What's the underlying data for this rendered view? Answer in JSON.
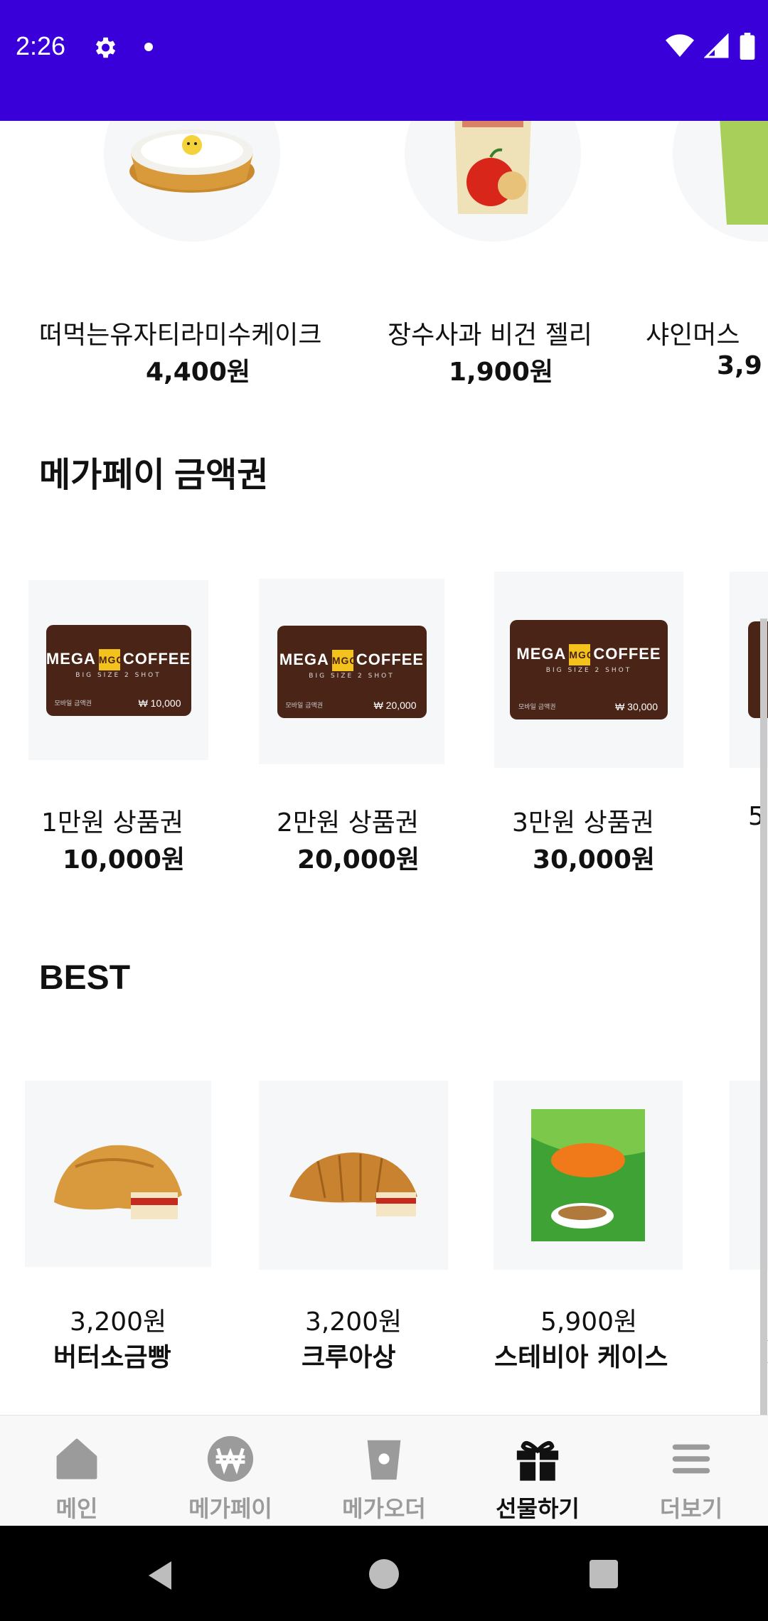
{
  "status_bar": {
    "time": "2:26",
    "background": "#3a00d9"
  },
  "top_products": [
    {
      "name": "떠먹는유자티라미수케이크",
      "price": "4,400원"
    },
    {
      "name": "장수사과 비건 젤리",
      "price": "1,900원"
    },
    {
      "name": "샤인머스",
      "price": "3,9"
    }
  ],
  "megapay_section": {
    "title": "메가페이 금액권",
    "cards": [
      {
        "name": "1만원 상품권",
        "price": "10,000원",
        "card_amount": "₩ 10,000"
      },
      {
        "name": "2만원 상품권",
        "price": "20,000원",
        "card_amount": "₩ 20,000"
      },
      {
        "name": "3만원 상품권",
        "price": "30,000원",
        "card_amount": "₩ 30,000"
      },
      {
        "name": "5",
        "price": "",
        "card_amount": ""
      }
    ],
    "card_logo_left": "MEGA",
    "card_logo_mid": "MGC",
    "card_logo_right": "COFFEE",
    "card_sub": "BIG SIZE   2 SHOT",
    "card_label": "모바일 금액권"
  },
  "best_section": {
    "title": "BEST",
    "items": [
      {
        "price": "3,200원",
        "name": "버터소금빵"
      },
      {
        "price": "3,200원",
        "name": "크루아상"
      },
      {
        "price": "5,900원",
        "name": "스테비아 케이스"
      },
      {
        "price": "",
        "name": "("
      }
    ]
  },
  "bottom_nav": [
    {
      "label": "메인",
      "icon": "home-icon"
    },
    {
      "label": "메가페이",
      "icon": "won-coin-icon"
    },
    {
      "label": "메가오더",
      "icon": "cup-icon"
    },
    {
      "label": "선물하기",
      "icon": "gift-icon",
      "active": true
    },
    {
      "label": "더보기",
      "icon": "menu-icon"
    }
  ],
  "colors": {
    "nav_inactive": "#9b9b9b",
    "nav_active": "#111111",
    "card_brown": "#4a2417",
    "card_yellow": "#f4c21d"
  }
}
